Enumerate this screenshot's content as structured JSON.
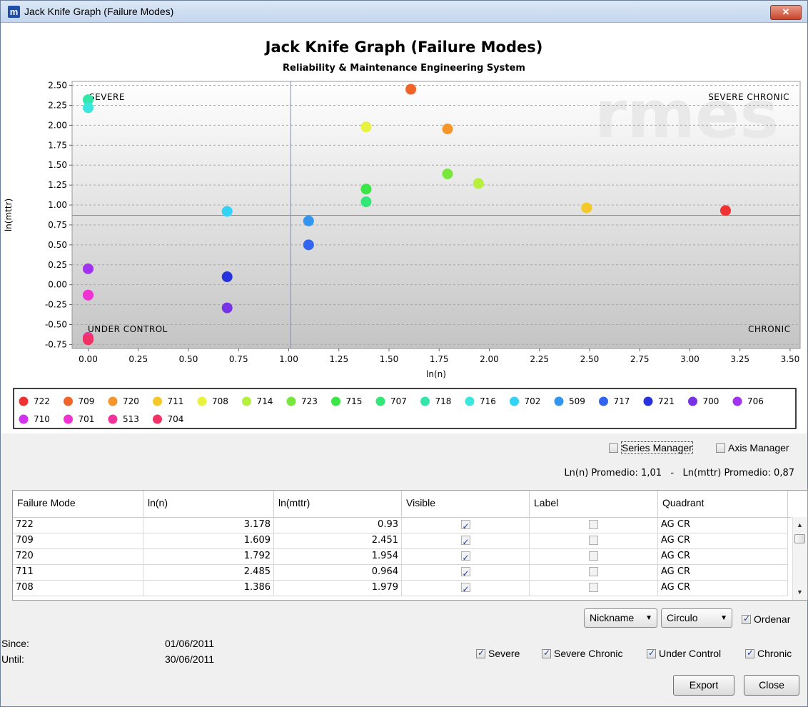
{
  "window": {
    "title": "Jack Knife Graph (Failure Modes)",
    "app_icon": "m",
    "close_glyph": "✕"
  },
  "chart_data": {
    "type": "scatter",
    "title": "Jack Knife Graph (Failure Modes)",
    "subtitle": "Reliability & Maintenance Engineering System",
    "xlabel": "ln(n)",
    "ylabel": "ln(mttr)",
    "watermark": "rmes",
    "xlim": [
      -0.08,
      3.55
    ],
    "ylim": [
      -0.8,
      2.55
    ],
    "xticks": [
      "0.00",
      "0.25",
      "0.50",
      "0.75",
      "1.00",
      "1.25",
      "1.50",
      "1.75",
      "2.00",
      "2.25",
      "2.50",
      "2.75",
      "3.00",
      "3.25",
      "3.50"
    ],
    "yticks": [
      "2.50",
      "2.25",
      "2.00",
      "1.75",
      "1.50",
      "1.25",
      "1.00",
      "0.75",
      "0.50",
      "0.25",
      "0.00",
      "-0.25",
      "-0.50",
      "-0.75"
    ],
    "grid": "horizontal dashed",
    "reference_lines": {
      "x": 1.01,
      "y": 0.87,
      "color": "#7b86e0"
    },
    "quadrants": {
      "top_left": "SEVERE",
      "top_right": "SEVERE CHRONIC",
      "bottom_left": "UNDER CONTROL",
      "bottom_right": "CHRONIC"
    },
    "series": [
      {
        "name": "722",
        "x": 3.178,
        "y": 0.93,
        "color": "#f03232"
      },
      {
        "name": "709",
        "x": 1.609,
        "y": 2.451,
        "color": "#f0642a"
      },
      {
        "name": "720",
        "x": 1.792,
        "y": 1.954,
        "color": "#f5962a"
      },
      {
        "name": "711",
        "x": 2.485,
        "y": 0.964,
        "color": "#f5c82a"
      },
      {
        "name": "708",
        "x": 1.386,
        "y": 1.979,
        "color": "#e6f23c"
      },
      {
        "name": "714",
        "x": 1.946,
        "y": 1.27,
        "color": "#b4f03c"
      },
      {
        "name": "723",
        "x": 1.792,
        "y": 1.39,
        "color": "#78e63c"
      },
      {
        "name": "715",
        "x": 1.386,
        "y": 1.2,
        "color": "#3ce646"
      },
      {
        "name": "707",
        "x": 1.386,
        "y": 1.04,
        "color": "#32e678"
      },
      {
        "name": "718",
        "x": 0.0,
        "y": 2.32,
        "color": "#32e6aa"
      },
      {
        "name": "716",
        "x": 0.0,
        "y": 2.22,
        "color": "#3ce6dc"
      },
      {
        "name": "702",
        "x": 0.693,
        "y": 0.92,
        "color": "#32d2f5"
      },
      {
        "name": "509",
        "x": 1.099,
        "y": 0.8,
        "color": "#3296f0"
      },
      {
        "name": "717",
        "x": 1.099,
        "y": 0.5,
        "color": "#3264f0"
      },
      {
        "name": "721",
        "x": 0.693,
        "y": 0.1,
        "color": "#2832dc"
      },
      {
        "name": "700",
        "x": 0.693,
        "y": -0.29,
        "color": "#7832e6"
      },
      {
        "name": "706",
        "x": 0.0,
        "y": 0.2,
        "color": "#a032f0"
      },
      {
        "name": "710",
        "x": 0.0,
        "y": -0.13,
        "color": "#d232f0"
      },
      {
        "name": "701",
        "x": 0.0,
        "y": -0.13,
        "color": "#f032d2"
      },
      {
        "name": "513",
        "x": 0.0,
        "y": -0.66,
        "color": "#f0329a"
      },
      {
        "name": "704",
        "x": 0.0,
        "y": -0.69,
        "color": "#f03264"
      }
    ]
  },
  "legend_items": [
    {
      "name": "722",
      "color": "#f03232"
    },
    {
      "name": "709",
      "color": "#f0642a"
    },
    {
      "name": "720",
      "color": "#f5962a"
    },
    {
      "name": "711",
      "color": "#f5c82a"
    },
    {
      "name": "708",
      "color": "#e6f23c"
    },
    {
      "name": "714",
      "color": "#b4f03c"
    },
    {
      "name": "723",
      "color": "#78e63c"
    },
    {
      "name": "715",
      "color": "#3ce646"
    },
    {
      "name": "707",
      "color": "#32e678"
    },
    {
      "name": "718",
      "color": "#32e6aa"
    },
    {
      "name": "716",
      "color": "#3ce6dc"
    },
    {
      "name": "702",
      "color": "#32d2f5"
    },
    {
      "name": "509",
      "color": "#3296f0"
    },
    {
      "name": "717",
      "color": "#3264f0"
    },
    {
      "name": "721",
      "color": "#2832dc"
    },
    {
      "name": "700",
      "color": "#7832e6"
    },
    {
      "name": "706",
      "color": "#a032f0"
    },
    {
      "name": "710",
      "color": "#d232f0"
    },
    {
      "name": "701",
      "color": "#f032d2"
    },
    {
      "name": "513",
      "color": "#f0329a"
    },
    {
      "name": "704",
      "color": "#f03264"
    }
  ],
  "managers": {
    "series_label": "Series Manager",
    "axis_label": "Axis Manager"
  },
  "stats": {
    "text": "Ln(n) Promedio: 1,01   -   Ln(mttr) Promedio: 0,87"
  },
  "table": {
    "columns": [
      "Failure Mode",
      "ln(n)",
      "ln(mttr)",
      "Visible",
      "Label",
      "Quadrant"
    ],
    "rows": [
      {
        "mode": "722",
        "ln_n": "3.178",
        "ln_mttr": "0.93",
        "visible": true,
        "label": false,
        "quadrant": "AG CR"
      },
      {
        "mode": "709",
        "ln_n": "1.609",
        "ln_mttr": "2.451",
        "visible": true,
        "label": false,
        "quadrant": "AG CR"
      },
      {
        "mode": "720",
        "ln_n": "1.792",
        "ln_mttr": "1.954",
        "visible": true,
        "label": false,
        "quadrant": "AG CR"
      },
      {
        "mode": "711",
        "ln_n": "2.485",
        "ln_mttr": "0.964",
        "visible": true,
        "label": false,
        "quadrant": "AG CR"
      },
      {
        "mode": "708",
        "ln_n": "1.386",
        "ln_mttr": "1.979",
        "visible": true,
        "label": false,
        "quadrant": "AG CR"
      }
    ]
  },
  "controls": {
    "nickname": "Nickname",
    "shape": "Circulo",
    "ordenar": "Ordenar",
    "filters": {
      "severe": "Severe",
      "severe_chronic": "Severe Chronic",
      "under_control": "Under Control",
      "chronic": "Chronic"
    }
  },
  "dates": {
    "since_label": "Since:",
    "since_value": "01/06/2011",
    "until_label": "Until:",
    "until_value": "30/06/2011"
  },
  "buttons": {
    "export": "Export",
    "close": "Close"
  }
}
